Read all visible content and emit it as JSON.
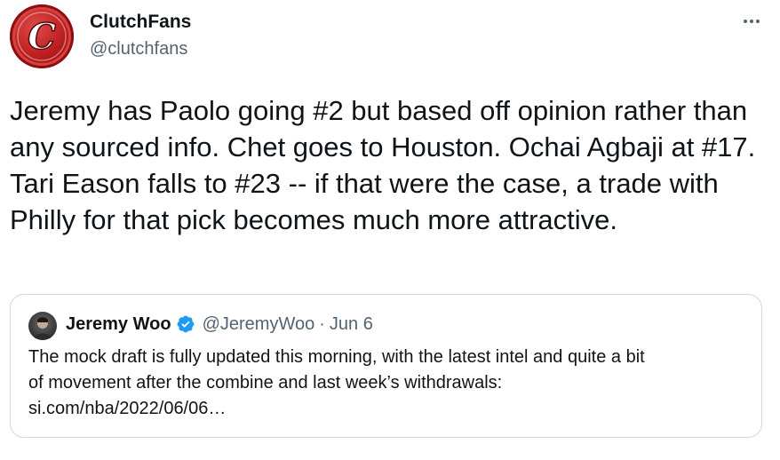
{
  "tweet": {
    "author": {
      "name": "ClutchFans",
      "handle": "@clutchfans",
      "avatar_icon": "clutchfans-logo-icon",
      "avatar_letter": "C"
    },
    "more_icon": "more-horizontal-icon",
    "text": "Jeremy has Paolo going #2 but based off opinion rather than any sourced info. Chet goes to Houston. Ochai Agbaji at #17. Tari Eason falls to #23 -- if that were the case, a trade with Philly for that pick becomes much more attractive."
  },
  "quote": {
    "author": {
      "name": "Jeremy Woo",
      "handle": "@JeremyWoo",
      "verified_icon": "verified-badge-icon",
      "avatar_icon": "user-avatar-icon"
    },
    "separator": "·",
    "date": "Jun 6",
    "text_lines": [
      "The mock draft is fully updated this morning, with the latest intel and quite a bit",
      "of movement after the combine and last week’s withdrawals:",
      "si.com/nba/2022/06/06…"
    ]
  },
  "colors": {
    "text_primary": "#0f1419",
    "text_secondary": "#536471",
    "border": "#cfd9de",
    "verified_blue": "#1d9bf0",
    "logo_red": "#b71c1c"
  }
}
